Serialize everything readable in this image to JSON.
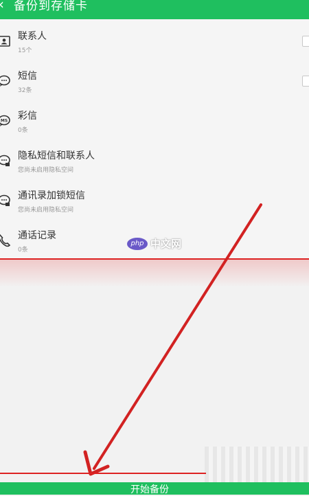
{
  "header": {
    "title": "备份到存储卡",
    "back_icon": "chevron-left-icon"
  },
  "items": [
    {
      "label": "联系人",
      "sub": "15个",
      "icon": "contact-icon"
    },
    {
      "label": "短信",
      "sub": "32条",
      "icon": "sms-icon"
    },
    {
      "label": "彩信",
      "sub": "0条",
      "icon": "mms-icon"
    },
    {
      "label": "隐私短信和联系人",
      "sub": "您尚未启用隐私空间",
      "icon": "private-sms-icon"
    },
    {
      "label": "通讯录加锁短信",
      "sub": "您尚未启用隐私空间",
      "icon": "locked-sms-icon"
    },
    {
      "label": "通话记录",
      "sub": "0条",
      "icon": "phone-icon"
    }
  ],
  "footer": {
    "button_label": "开始备份"
  },
  "watermark": {
    "logo": "php",
    "text": "中文网"
  },
  "colors": {
    "accent": "#1fbf5f",
    "annotation": "#d22222"
  }
}
